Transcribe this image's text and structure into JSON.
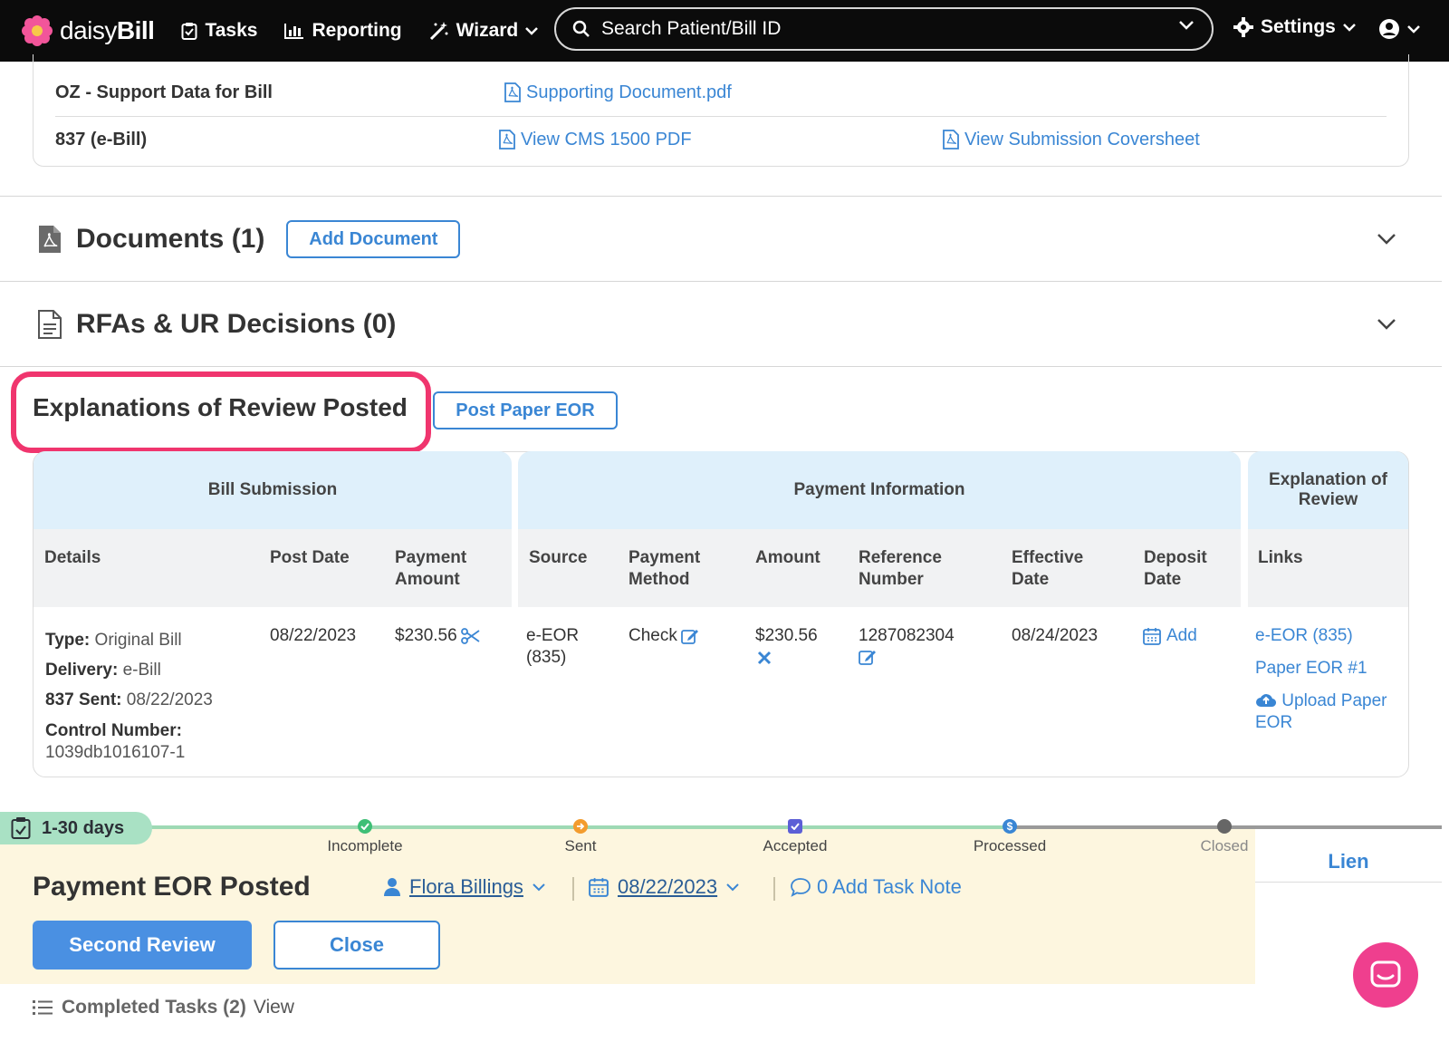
{
  "nav": {
    "brand_light": "daisy",
    "brand_bold": "Bill",
    "tasks": "Tasks",
    "reporting": "Reporting",
    "wizard": "Wizard",
    "search_placeholder": "Search Patient/Bill ID",
    "settings": "Settings"
  },
  "support": {
    "rows": [
      {
        "label": "OZ - Support Data for Bill",
        "link1": "Supporting Document.pdf",
        "link2": ""
      },
      {
        "label": "837 (e-Bill)",
        "link1": "View CMS 1500 PDF",
        "link2": "View Submission Coversheet"
      }
    ]
  },
  "documents": {
    "title": "Documents (1)",
    "button": "Add Document"
  },
  "rfas": {
    "title": "RFAs & UR Decisions (0)"
  },
  "eor": {
    "title": "Explanations of Review Posted",
    "button": "Post Paper EOR",
    "groups": [
      "Bill Submission",
      "Payment Information",
      "Explanation of Review"
    ],
    "headers": {
      "details": "Details",
      "post_date": "Post Date",
      "payment_amount": "Payment Amount",
      "source": "Source",
      "payment_method": "Payment Method",
      "amount": "Amount",
      "reference_number": "Reference Number",
      "effective_date": "Effective Date",
      "deposit_date": "Deposit Date",
      "links": "Links"
    },
    "row": {
      "type_label": "Type:",
      "type_value": "Original Bill",
      "delivery_label": "Delivery:",
      "delivery_value": "e-Bill",
      "sent_label": "837 Sent:",
      "sent_value": "08/22/2023",
      "control_label": "Control Number:",
      "control_value": "1039db1016107-1",
      "post_date": "08/22/2023",
      "payment_amount": "$230.56",
      "source": "e-EOR (835)",
      "payment_method": "Check",
      "amount": "$230.56",
      "reference_number": "1287082304",
      "effective_date": "08/24/2023",
      "deposit_add": "Add",
      "link_eeor": "e-EOR (835)",
      "link_paper": "Paper EOR #1",
      "link_upload": "Upload Paper EOR"
    }
  },
  "task": {
    "days": "1-30 days",
    "steps": [
      "Incomplete",
      "Sent",
      "Accepted",
      "Processed",
      "Closed"
    ],
    "lien": "Lien",
    "title": "Payment EOR Posted",
    "assignee": "Flora Billings",
    "due_date": "08/22/2023",
    "note": "0 Add Task Note",
    "primary_button": "Second Review",
    "close_button": "Close",
    "completed_label": "Completed Tasks (2)",
    "completed_view": "View"
  },
  "colors": {
    "accent": "#3a86d4",
    "highlight": "#f0356e",
    "header_bg": "#dff0fb",
    "task_bg": "#fdf6df"
  }
}
